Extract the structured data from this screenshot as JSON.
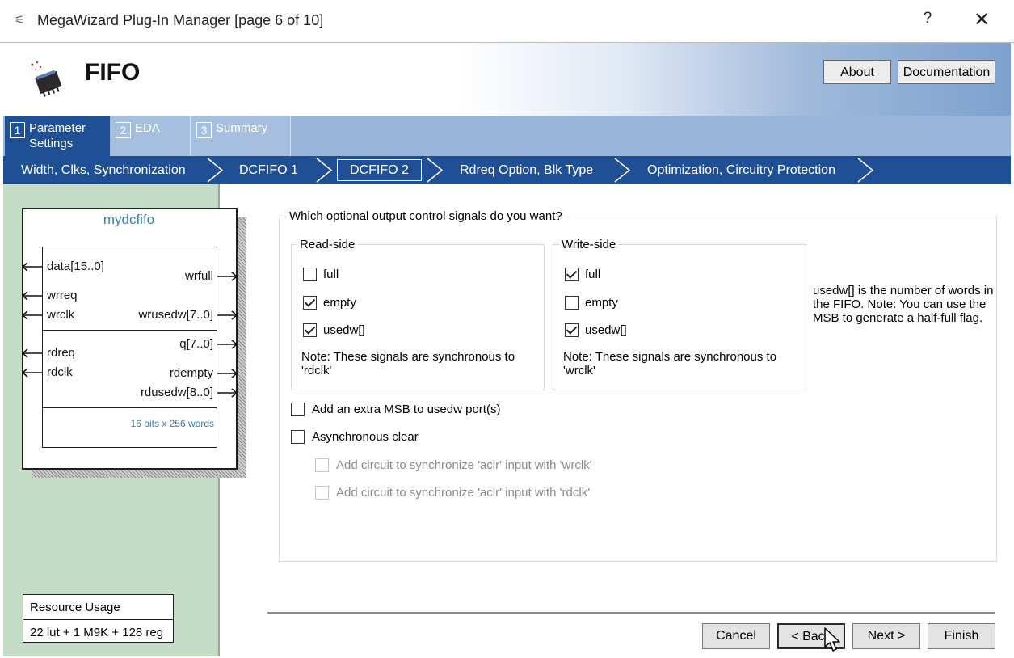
{
  "window": {
    "title": "MegaWizard Plug-In Manager [page 6 of 10]",
    "help_label": "?",
    "close_label": "✕"
  },
  "header": {
    "title": "FIFO",
    "about_label": "About",
    "documentation_label": "Documentation"
  },
  "tabs": [
    {
      "number": "1",
      "label": "Parameter Settings",
      "active": true
    },
    {
      "number": "2",
      "label": "EDA",
      "active": false
    },
    {
      "number": "3",
      "label": "Summary",
      "active": false
    }
  ],
  "breadcrumb": [
    {
      "label": "Width, Clks, Synchronization",
      "active": false
    },
    {
      "label": "DCFIFO 1",
      "active": false
    },
    {
      "label": "DCFIFO 2",
      "active": true
    },
    {
      "label": "Rdreq Option, Blk Type",
      "active": false
    },
    {
      "label": "Optimization, Circuitry Protection",
      "active": false
    }
  ],
  "diagram": {
    "name": "mydcfifo",
    "left_pins": [
      "data[15..0]",
      "wrreq",
      "wrclk",
      "rdreq",
      "rdclk"
    ],
    "right_pins": [
      "wrfull",
      "wrusedw[7..0]",
      "q[7..0]",
      "rdempty",
      "rdusedw[8..0]"
    ],
    "caption": "16 bits x 256 words"
  },
  "resource": {
    "title": "Resource Usage",
    "value": "22 lut + 1 M9K + 128 reg"
  },
  "main": {
    "question": "Which optional output control signals do you want?",
    "read_side": {
      "title": "Read-side",
      "options": [
        {
          "label": "full",
          "checked": false
        },
        {
          "label": "empty",
          "checked": true
        },
        {
          "label": "usedw[]",
          "checked": true
        }
      ],
      "note": "Note: These signals are synchronous to 'rdclk'"
    },
    "write_side": {
      "title": "Write-side",
      "options": [
        {
          "label": "full",
          "checked": true
        },
        {
          "label": "empty",
          "checked": false
        },
        {
          "label": "usedw[]",
          "checked": true
        }
      ],
      "note": "Note: These signals are synchronous to 'wrclk'"
    },
    "side_note": "usedw[] is the number of words in the FIFO. Note: You can use the MSB to generate a half-full flag.",
    "extra_msb": {
      "label": "Add an extra MSB to usedw port(s)",
      "checked": false
    },
    "async_clear": {
      "label": "Asynchronous clear",
      "checked": false
    },
    "sync_wrclk": {
      "label": "Add circuit to synchronize 'aclr' input with 'wrclk'",
      "checked": false,
      "enabled": false
    },
    "sync_rdclk": {
      "label": "Add circuit to synchronize 'aclr' input with 'rdclk'",
      "checked": false,
      "enabled": false
    }
  },
  "footer": {
    "cancel_label": "Cancel",
    "back_label": "< Back",
    "next_label": "Next >",
    "finish_label": "Finish"
  },
  "colors": {
    "nav_dark": "#1f4f94",
    "tab_light": "#a7bfdf",
    "left_panel": "#c3ddc7",
    "diagram_name": "#3a7ea6"
  }
}
